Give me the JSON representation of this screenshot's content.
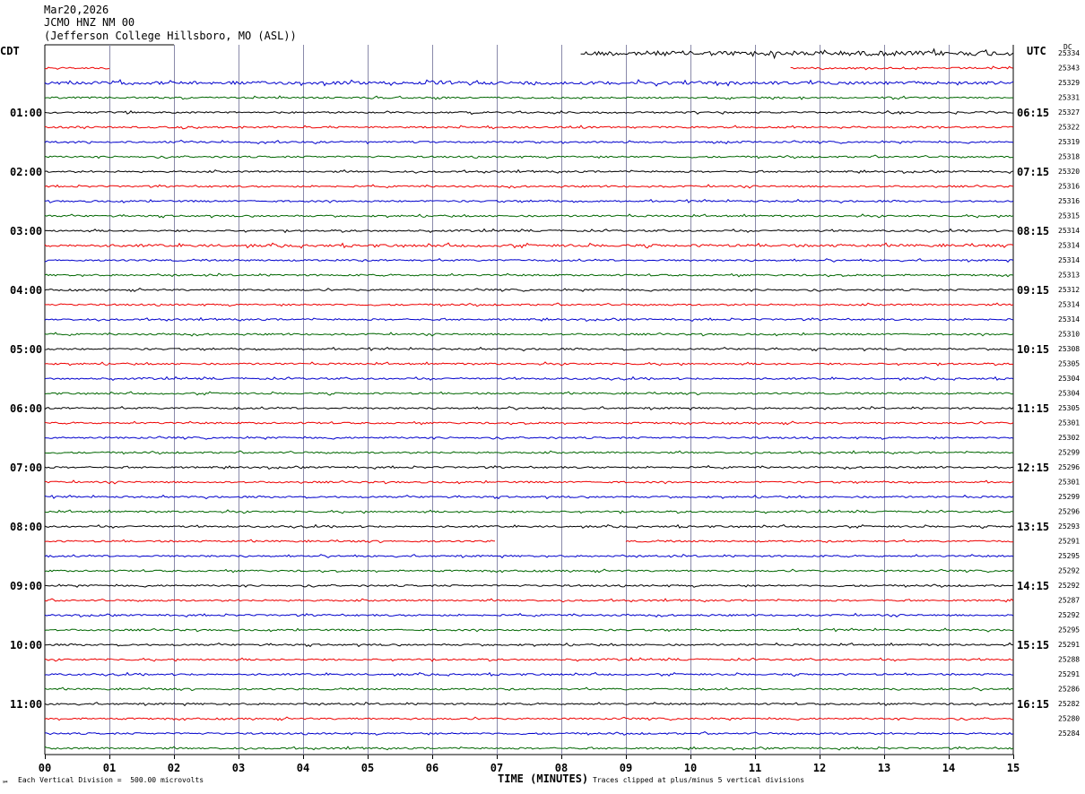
{
  "header": {
    "date": "Mar20,2026",
    "station": "JCMO HNZ NM 00",
    "location": "(Jefferson College Hillsboro, MO (ASL))"
  },
  "left_axis_title": "CDT",
  "right_axis_title": "UTC",
  "dc_label": "DC",
  "footer": {
    "scale_note": "Each Vertical Division =  500.00 microvolts",
    "clip_note": "Traces clipped at plus/minus 5 vertical divisions",
    "xlabel": "TIME (MINUTES)",
    "mark": "℠"
  },
  "colors": {
    "cycle": [
      "#000000",
      "#ee0000",
      "#0000cc",
      "#006600"
    ],
    "grid": "#8a8aaa"
  },
  "chart_data": {
    "type": "line",
    "title": "",
    "xlabel": "TIME (MINUTES)",
    "ylabel": "",
    "xlim": [
      0,
      15
    ],
    "x_ticks": [
      "00",
      "01",
      "02",
      "03",
      "04",
      "05",
      "06",
      "07",
      "08",
      "09",
      "10",
      "11",
      "12",
      "13",
      "14",
      "15"
    ],
    "row_count": 48,
    "left_hour_labels": [
      "01:00",
      "02:00",
      "03:00",
      "04:00",
      "05:00",
      "06:00",
      "07:00",
      "08:00",
      "09:00",
      "10:00",
      "11:00"
    ],
    "right_hour_labels": [
      "06:15",
      "07:15",
      "08:15",
      "09:15",
      "10:15",
      "11:15",
      "12:15",
      "13:15",
      "14:15",
      "15:15",
      "16:15"
    ],
    "hour_label_rows": [
      4,
      8,
      12,
      16,
      20,
      24,
      28,
      32,
      36,
      40,
      44
    ],
    "dc_values": [
      25334,
      25343,
      25329,
      25331,
      25327,
      25322,
      25319,
      25318,
      25320,
      25316,
      25316,
      25315,
      25314,
      25314,
      25314,
      25313,
      25312,
      25314,
      25314,
      25310,
      25308,
      25305,
      25304,
      25304,
      25305,
      25301,
      25302,
      25299,
      25296,
      25301,
      25299,
      25296,
      25293,
      25291,
      25295,
      25292,
      25292,
      25287,
      25292,
      25295,
      25291,
      25288,
      25291,
      25286,
      25282,
      25280,
      25284
    ],
    "trace_segments": {
      "0": [
        [
          8.3,
          15
        ]
      ],
      "1": [
        [
          0,
          1
        ],
        [
          11.55,
          15
        ]
      ],
      "2": [
        [
          0,
          15
        ]
      ],
      "33": [
        [
          0,
          6.98
        ],
        [
          9.0,
          15
        ]
      ]
    },
    "noise_amplitude": {
      "0": 2.5,
      "2": 1.6,
      "13": 1.3
    }
  }
}
